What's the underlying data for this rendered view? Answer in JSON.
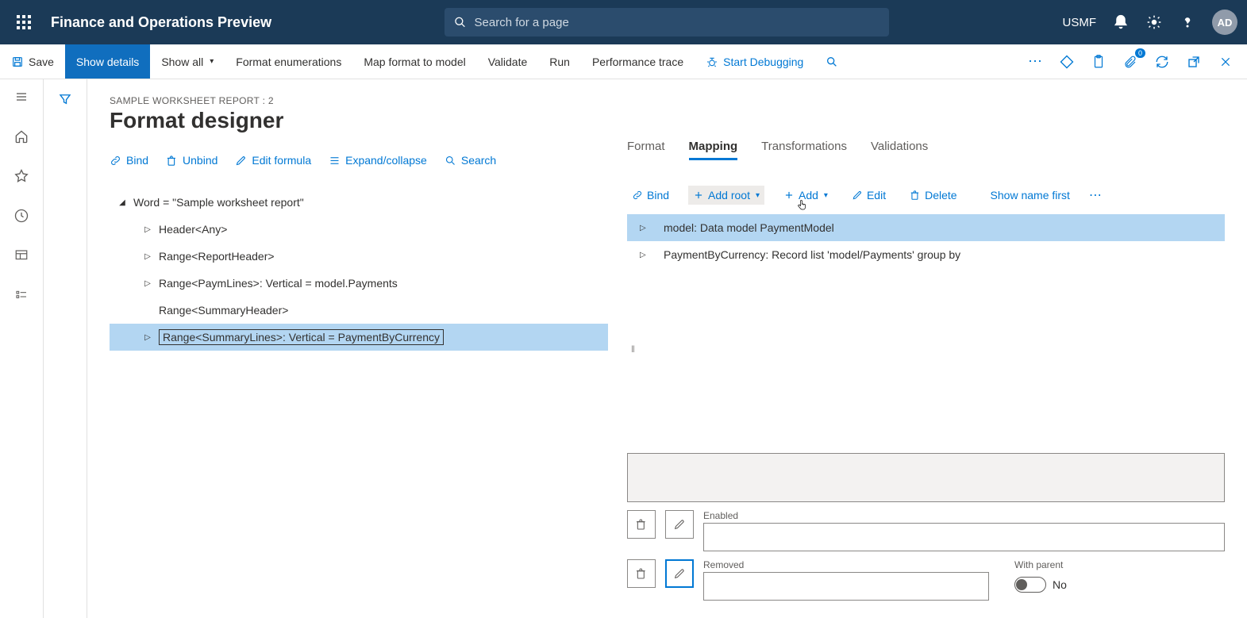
{
  "header": {
    "app_title": "Finance and Operations Preview",
    "search_placeholder": "Search for a page",
    "company": "USMF",
    "avatar": "AD"
  },
  "action_bar": {
    "save": "Save",
    "show_details": "Show details",
    "show_all": "Show all",
    "format_enum": "Format enumerations",
    "map_format": "Map format to model",
    "validate": "Validate",
    "run": "Run",
    "perf_trace": "Performance trace",
    "start_debug": "Start Debugging",
    "attach_badge": "0"
  },
  "page": {
    "breadcrumb": "SAMPLE WORKSHEET REPORT : 2",
    "title": "Format designer"
  },
  "left_tools": {
    "bind": "Bind",
    "unbind": "Unbind",
    "edit_formula": "Edit formula",
    "expand": "Expand/collapse",
    "search": "Search"
  },
  "tree": {
    "root": "Word = \"Sample worksheet report\"",
    "n1": "Header<Any>",
    "n2": "Range<ReportHeader>",
    "n3": "Range<PaymLines>: Vertical = model.Payments",
    "n4": "Range<SummaryHeader>",
    "n5": "Range<SummaryLines>: Vertical = PaymentByCurrency"
  },
  "tabs": {
    "format": "Format",
    "mapping": "Mapping",
    "transformations": "Transformations",
    "validations": "Validations"
  },
  "map_tools": {
    "bind": "Bind",
    "add_root": "Add root",
    "add": "Add",
    "edit": "Edit",
    "delete": "Delete",
    "show_name": "Show name first"
  },
  "map_tree": {
    "r1": "model: Data model PaymentModel",
    "r2": "PaymentByCurrency: Record list 'model/Payments' group by"
  },
  "props": {
    "enabled_label": "Enabled",
    "removed_label": "Removed",
    "with_parent_label": "With parent",
    "with_parent_value": "No"
  }
}
